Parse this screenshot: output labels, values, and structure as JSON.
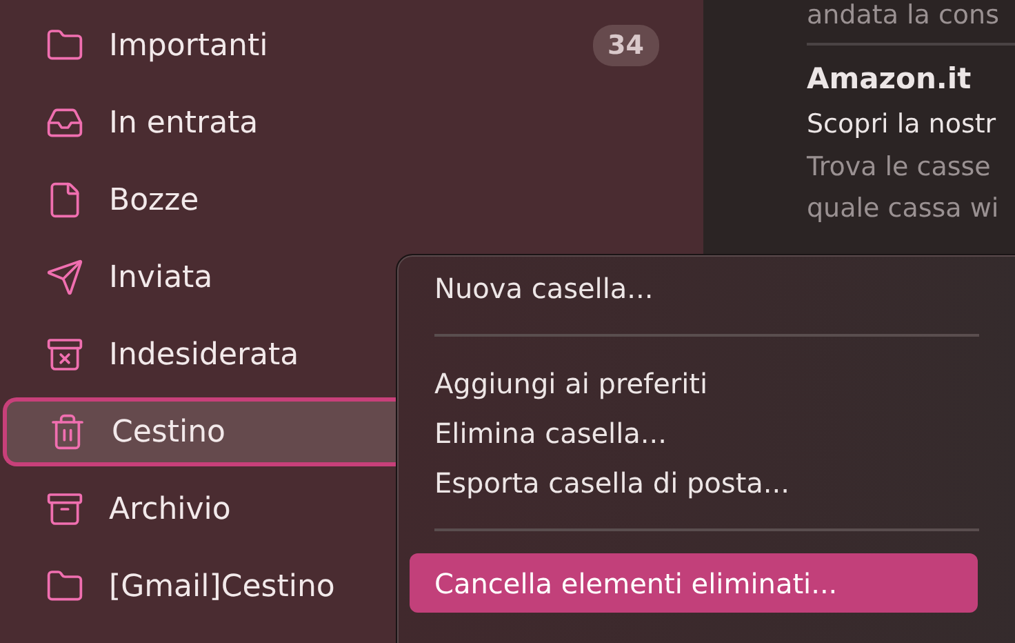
{
  "sidebar": {
    "items": [
      {
        "label": "Importanti",
        "kind": "folder",
        "badge": "34",
        "selected": false
      },
      {
        "label": "In entrata",
        "kind": "inbox",
        "selected": false
      },
      {
        "label": "Bozze",
        "kind": "draft",
        "selected": false
      },
      {
        "label": "Inviata",
        "kind": "sent",
        "selected": false
      },
      {
        "label": "Indesiderata",
        "kind": "junk",
        "selected": false
      },
      {
        "label": "Cestino",
        "kind": "trash",
        "selected": true
      },
      {
        "label": "Archivio",
        "kind": "archive",
        "selected": false
      },
      {
        "label": "[Gmail]Cestino",
        "kind": "folder",
        "selected": false
      }
    ]
  },
  "message_list": {
    "top_snippet": "andata la cons",
    "messages": [
      {
        "sender": "Amazon.it",
        "subject": "Scopri la nostr",
        "preview": [
          "Trova le casse",
          "quale cassa wi"
        ]
      }
    ]
  },
  "context_menu": {
    "items": [
      {
        "kind": "item",
        "label": "Nuova casella...",
        "selected": false
      },
      {
        "kind": "separator"
      },
      {
        "kind": "item",
        "label": "Aggiungi ai preferiti",
        "selected": false
      },
      {
        "kind": "item",
        "label": "Elimina casella...",
        "selected": false
      },
      {
        "kind": "item",
        "label": "Esporta casella di posta...",
        "selected": false
      },
      {
        "kind": "separator"
      },
      {
        "kind": "item",
        "label": "Cancella elementi eliminati...",
        "selected": true
      }
    ]
  }
}
